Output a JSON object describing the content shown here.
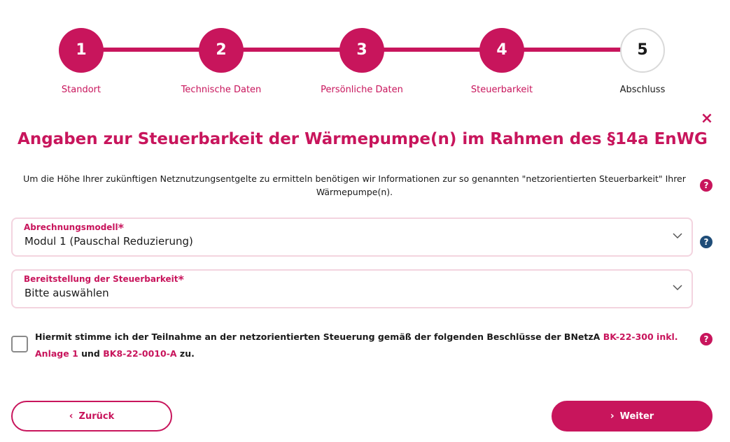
{
  "stepper": {
    "steps": [
      {
        "number": "1",
        "label": "Standort",
        "state": "done"
      },
      {
        "number": "2",
        "label": "Technische Daten",
        "state": "done"
      },
      {
        "number": "3",
        "label": "Persönliche Daten",
        "state": "done"
      },
      {
        "number": "4",
        "label": "Steuerbarkeit",
        "state": "active"
      },
      {
        "number": "5",
        "label": "Abschluss",
        "state": "pending"
      }
    ]
  },
  "close_icon": "×",
  "title": "Angaben zur Steuerbarkeit der Wärmepumpe(n) im Rahmen des §14a EnWG",
  "intro": "Um die Höhe Ihrer zukünftigen Netznutzungsentgelte zu ermitteln benötigen wir Informationen zur so genannten \"netzorientierten Steuerbarkeit\" Ihrer Wärmepumpe(n).",
  "help_glyph": "?",
  "fields": {
    "abrechnungsmodell": {
      "label": "Abrechnungsmodell",
      "required": "*",
      "value": "Modul 1 (Pauschal Reduzierung)"
    },
    "bereitstellung": {
      "label": "Bereitstellung der Steuerbarkeit",
      "required": "*",
      "value": "Bitte auswählen"
    }
  },
  "consent": {
    "text_before": "Hiermit stimme ich der Teilnahme an der netzorientierten Steuerung gemäß der folgenden Beschlüsse der BNetzA ",
    "link1": "BK-22-300 inkl. Anlage 1",
    "text_middle": " und ",
    "link2": "BK8-22-0010-A",
    "text_after": " zu."
  },
  "buttons": {
    "back": {
      "arrow": "‹",
      "label": "Zurück"
    },
    "next": {
      "arrow": "›",
      "label": "Weiter"
    }
  },
  "colors": {
    "accent": "#c8155c",
    "help_blue": "#1f4d78",
    "field_border": "#f3d4df"
  },
  "icons": [
    "close-icon",
    "help-icon",
    "chevron-down-icon",
    "chevron-left-icon",
    "chevron-right-icon"
  ]
}
